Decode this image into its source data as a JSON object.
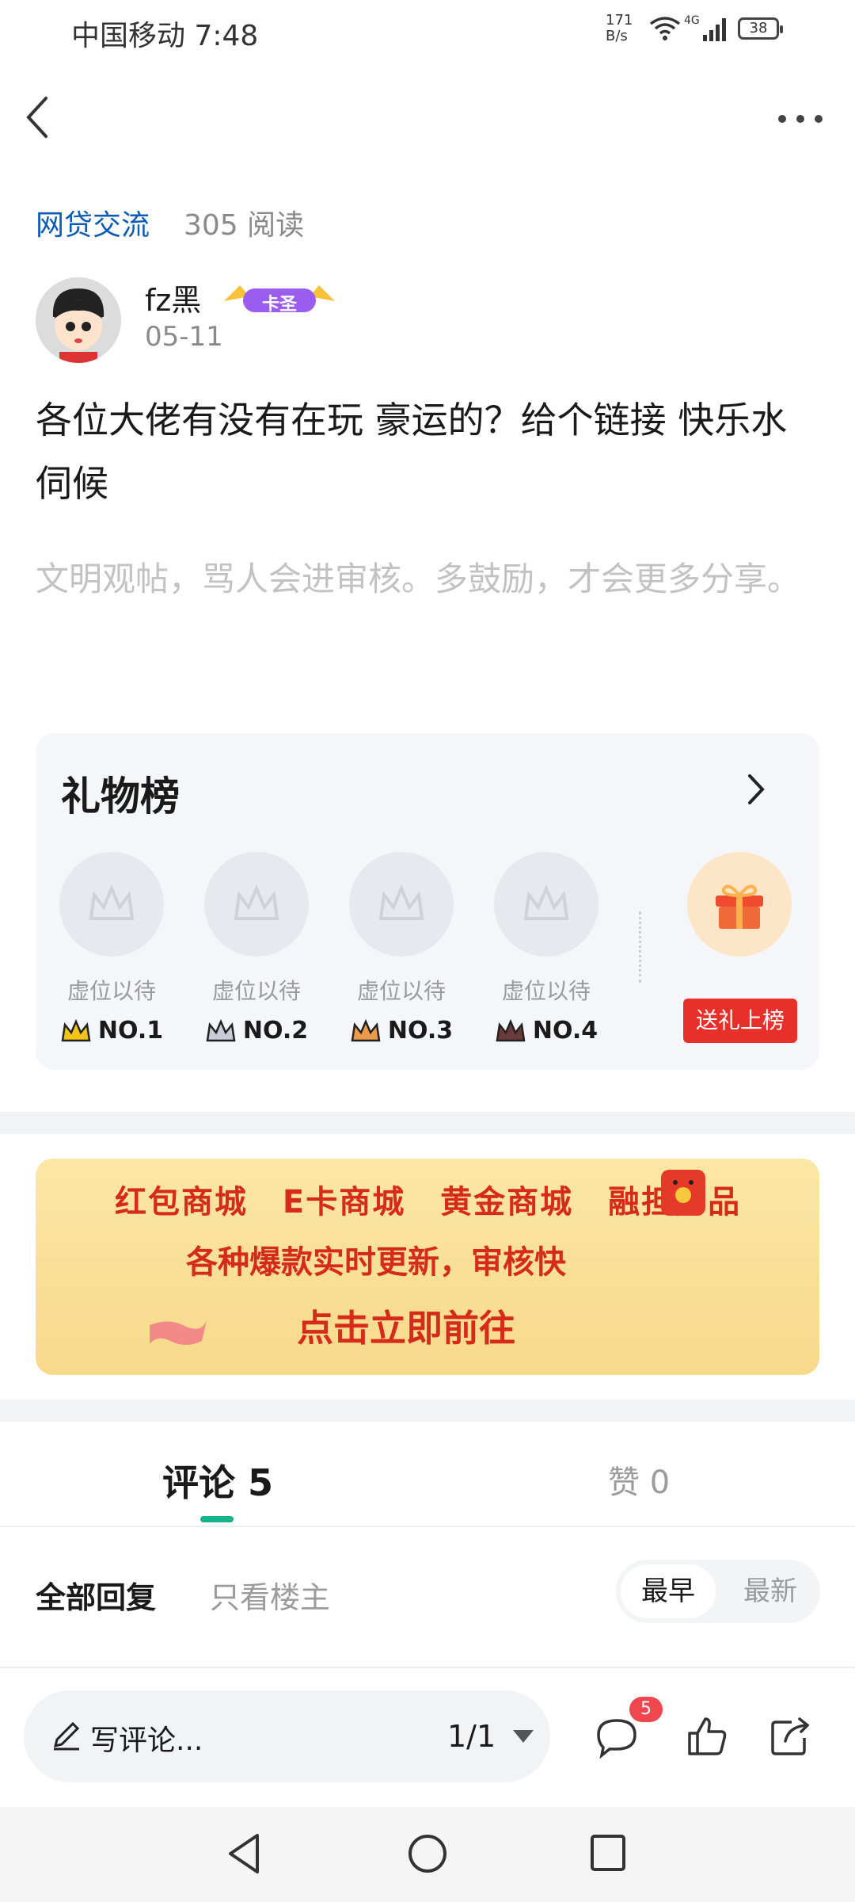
{
  "status_bar": {
    "carrier_time": "中国移动 7:48",
    "speed_value": "171",
    "speed_unit": "B/s",
    "network": "4G",
    "battery": "38"
  },
  "topbar": {
    "back_icon": "chevron-left-icon",
    "more_icon": "more-dots-icon"
  },
  "post": {
    "category": "网贷交流",
    "reads": "305 阅读",
    "author": "fz黑",
    "badge_text": "卡圣",
    "date": "05-11",
    "content": "各位大佬有没有在玩  豪运的？给个链接  快乐水伺候",
    "notice": "文明观帖，骂人会进审核。多鼓励，才会更多分享。"
  },
  "gift_board": {
    "title": "礼物榜",
    "slots": [
      {
        "label": "虚位以待",
        "rank": "NO.1",
        "crown_color": "#f3c316"
      },
      {
        "label": "虚位以待",
        "rank": "NO.2",
        "crown_color": "#c9cbd6"
      },
      {
        "label": "虚位以待",
        "rank": "NO.3",
        "crown_color": "#e99a4b"
      },
      {
        "label": "虚位以待",
        "rank": "NO.4",
        "crown_color": "#6b3a3a"
      }
    ],
    "send_button": "送礼上榜"
  },
  "banner": {
    "row1": "红包商城 E卡商城 黄金商城 融担产品",
    "row2": "各种爆款实时更新，审核快",
    "row3": "点击立即前往"
  },
  "tabs": {
    "comments": "评论 5",
    "likes": "赞 0"
  },
  "filters": {
    "all": "全部回复",
    "op_only": "只看楼主",
    "earliest": "最早",
    "newest": "最新"
  },
  "bottom_bar": {
    "placeholder": "写评论...",
    "page": "1/1",
    "comment_count": "5"
  },
  "colors": {
    "accent": "#17b38a",
    "link": "#0c5bb7",
    "red": "#e8302b"
  }
}
